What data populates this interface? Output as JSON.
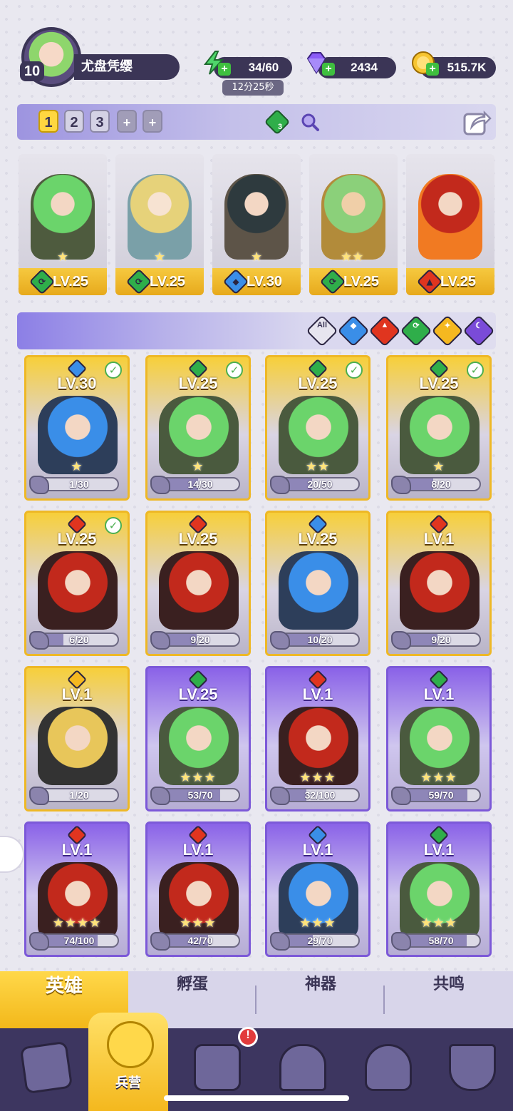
{
  "player": {
    "level": "10",
    "name": "尤盘凭缨"
  },
  "resources": {
    "energy": "34/60",
    "energy_timer": "12分25秒",
    "gems": "2434",
    "coins": "515.7K"
  },
  "team": {
    "tabs": [
      "1",
      "2",
      "3",
      "+",
      "+"
    ],
    "active_tab": "1",
    "team_count_badge": "3"
  },
  "lineup": [
    {
      "level": "LV.25",
      "element": "wind",
      "stars": 1
    },
    {
      "level": "LV.25",
      "element": "wind",
      "stars": 1
    },
    {
      "level": "LV.30",
      "element": "water",
      "stars": 1
    },
    {
      "level": "LV.25",
      "element": "wind",
      "stars": 2
    },
    {
      "level": "LV.25",
      "element": "fire",
      "stars": 0
    }
  ],
  "filters": {
    "all_label": "All",
    "elements": [
      "water",
      "fire",
      "wind",
      "light",
      "dark"
    ]
  },
  "heroes": [
    {
      "level": "LV.30",
      "element": "water",
      "shards": "1/30",
      "progress": 0.03,
      "in_team": true,
      "rarity": "gold",
      "stars": 1
    },
    {
      "level": "LV.25",
      "element": "wind",
      "shards": "14/30",
      "progress": 0.47,
      "in_team": true,
      "rarity": "gold",
      "stars": 1
    },
    {
      "level": "LV.25",
      "element": "wind",
      "shards": "20/50",
      "progress": 0.4,
      "in_team": true,
      "rarity": "gold",
      "stars": 2
    },
    {
      "level": "LV.25",
      "element": "wind",
      "shards": "8/20",
      "progress": 0.4,
      "in_team": true,
      "rarity": "gold",
      "stars": 1
    },
    {
      "level": "LV.25",
      "element": "fire",
      "shards": "6/20",
      "progress": 0.3,
      "in_team": true,
      "rarity": "gold",
      "stars": 0
    },
    {
      "level": "LV.25",
      "element": "fire",
      "shards": "9/20",
      "progress": 0.45,
      "in_team": false,
      "rarity": "gold",
      "stars": 0
    },
    {
      "level": "LV.25",
      "element": "water",
      "shards": "10/20",
      "progress": 0.5,
      "in_team": false,
      "rarity": "gold",
      "stars": 0
    },
    {
      "level": "LV.1",
      "element": "fire",
      "shards": "9/20",
      "progress": 0.45,
      "in_team": false,
      "rarity": "gold",
      "stars": 0
    },
    {
      "level": "LV.1",
      "element": "light",
      "shards": "1/20",
      "progress": 0.05,
      "in_team": false,
      "rarity": "gold",
      "stars": 0
    },
    {
      "level": "LV.25",
      "element": "wind",
      "shards": "53/70",
      "progress": 0.76,
      "in_team": false,
      "rarity": "purple",
      "stars": 3
    },
    {
      "level": "LV.1",
      "element": "fire",
      "shards": "32/100",
      "progress": 0.32,
      "in_team": false,
      "rarity": "purple",
      "stars": 3
    },
    {
      "level": "LV.1",
      "element": "wind",
      "shards": "59/70",
      "progress": 0.84,
      "in_team": false,
      "rarity": "purple",
      "stars": 3
    },
    {
      "level": "LV.1",
      "element": "fire",
      "shards": "74/100",
      "progress": 0.74,
      "in_team": false,
      "rarity": "purple",
      "stars": 4
    },
    {
      "level": "LV.1",
      "element": "fire",
      "shards": "42/70",
      "progress": 0.6,
      "in_team": false,
      "rarity": "purple",
      "stars": 3
    },
    {
      "level": "LV.1",
      "element": "water",
      "shards": "29/70",
      "progress": 0.41,
      "in_team": false,
      "rarity": "purple",
      "stars": 3
    },
    {
      "level": "LV.1",
      "element": "wind",
      "shards": "58/70",
      "progress": 0.83,
      "in_team": false,
      "rarity": "purple",
      "stars": 3
    }
  ],
  "sub_tabs": [
    "英雄",
    "孵蛋",
    "神器",
    "共鸣"
  ],
  "nav": {
    "active_label": "兵营",
    "alert": "!",
    "icons": [
      "cards-icon",
      "barracks-icon",
      "map-icon",
      "castle-icon",
      "mushroom-icon",
      "guild-banner-icon"
    ]
  },
  "colors": {
    "water": "#3a8ee8",
    "fire": "#e0351f",
    "wind": "#2fae4a",
    "light": "#f5b820",
    "dark": "#7a4bd8",
    "gold_card": "#f5c534",
    "purple_card": "#8a62e8",
    "panel_dark": "#3b3556"
  }
}
